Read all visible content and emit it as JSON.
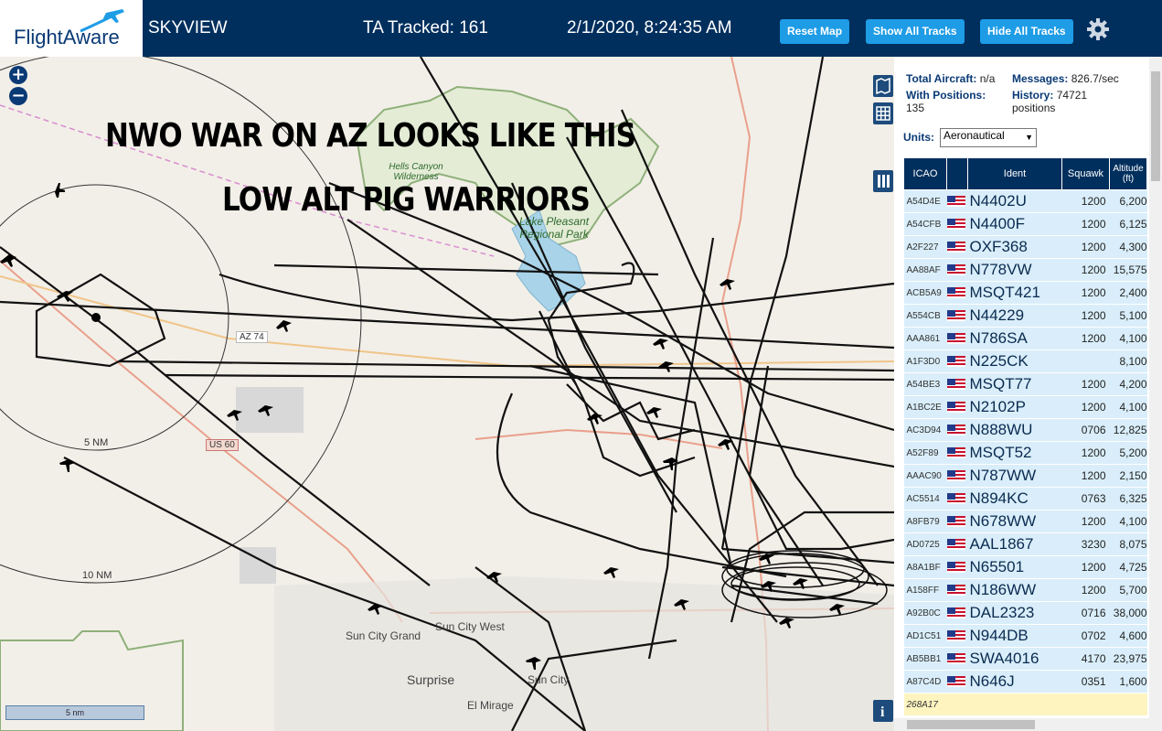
{
  "header": {
    "brand": "FlightAware",
    "app_name": "SKYVIEW",
    "tracked": "TA Tracked: 161",
    "datetime": "2/1/2020, 8:24:35 AM",
    "reset_map": "Reset Map",
    "show_tracks": "Show All Tracks",
    "hide_tracks": "Hide All Tracks"
  },
  "map": {
    "zoom_in": "+",
    "zoom_out": "−",
    "overlay_line1": "NWO WAR ON AZ LOOKS LIKE THIS",
    "overlay_line2": "LOW ALT PIG WARRIORS",
    "ring_5": "5 NM",
    "ring_10": "10 NM",
    "scale": "5 nm",
    "route_az74": "AZ 74",
    "route_us60": "US 60",
    "places": {
      "hells_canyon": "Hells Canyon Wilderness",
      "lake_pleasant": "Lake Pleasant Regional Park",
      "sun_city_grand": "Sun City Grand",
      "sun_city_west": "Sun City West",
      "sun_city": "Sun City",
      "surprise": "Surprise",
      "el_mirage": "El Mirage"
    }
  },
  "sidebar": {
    "total_aircraft_label": "Total Aircraft:",
    "total_aircraft_value": "n/a",
    "messages_label": "Messages:",
    "messages_value": "826.7/sec",
    "with_positions_label": "With Positions:",
    "with_positions_value": "135",
    "history_label": "History:",
    "history_value": "74721",
    "history_unit": "positions",
    "units_label": "Units:",
    "units_value": "Aeronautical",
    "columns": [
      "ICAO",
      "",
      "Ident",
      "Squawk",
      "Altitude (ft)"
    ],
    "rows": [
      {
        "icao": "A54D4E",
        "ident": "N4402U",
        "squawk": "1200",
        "alt": "6,200"
      },
      {
        "icao": "A54CFB",
        "ident": "N4400F",
        "squawk": "1200",
        "alt": "6,125"
      },
      {
        "icao": "A2F227",
        "ident": "OXF368",
        "squawk": "1200",
        "alt": "4,300"
      },
      {
        "icao": "AA88AF",
        "ident": "N778VW",
        "squawk": "1200",
        "alt": "15,575"
      },
      {
        "icao": "ACB5A9",
        "ident": "MSQT421",
        "squawk": "1200",
        "alt": "2,400"
      },
      {
        "icao": "A554CB",
        "ident": "N44229",
        "squawk": "1200",
        "alt": "5,100"
      },
      {
        "icao": "AAA861",
        "ident": "N786SA",
        "squawk": "1200",
        "alt": "4,100"
      },
      {
        "icao": "A1F3D0",
        "ident": "N225CK",
        "squawk": "",
        "alt": "8,100"
      },
      {
        "icao": "A54BE3",
        "ident": "MSQT77",
        "squawk": "1200",
        "alt": "4,200"
      },
      {
        "icao": "A1BC2E",
        "ident": "N2102P",
        "squawk": "1200",
        "alt": "4,100"
      },
      {
        "icao": "AC3D94",
        "ident": "N888WU",
        "squawk": "0706",
        "alt": "12,825"
      },
      {
        "icao": "A52F89",
        "ident": "MSQT52",
        "squawk": "1200",
        "alt": "5,200"
      },
      {
        "icao": "AAAC90",
        "ident": "N787WW",
        "squawk": "1200",
        "alt": "2,150"
      },
      {
        "icao": "AC5514",
        "ident": "N894KC",
        "squawk": "0763",
        "alt": "6,325"
      },
      {
        "icao": "A8FB79",
        "ident": "N678WW",
        "squawk": "1200",
        "alt": "4,100"
      },
      {
        "icao": "AD0725",
        "ident": "AAL1867",
        "squawk": "3230",
        "alt": "8,075"
      },
      {
        "icao": "A8A1BF",
        "ident": "N65501",
        "squawk": "1200",
        "alt": "4,725"
      },
      {
        "icao": "A158FF",
        "ident": "N186WW",
        "squawk": "1200",
        "alt": "5,700"
      },
      {
        "icao": "A92B0C",
        "ident": "DAL2323",
        "squawk": "0716",
        "alt": "38,000"
      },
      {
        "icao": "AD1C51",
        "ident": "N944DB",
        "squawk": "0702",
        "alt": "4,600"
      },
      {
        "icao": "AB5BB1",
        "ident": "SWA4016",
        "squawk": "4170",
        "alt": "23,975"
      },
      {
        "icao": "A87C4D",
        "ident": "N646J",
        "squawk": "0351",
        "alt": "1,600"
      }
    ],
    "pending_icao": "268A17"
  }
}
